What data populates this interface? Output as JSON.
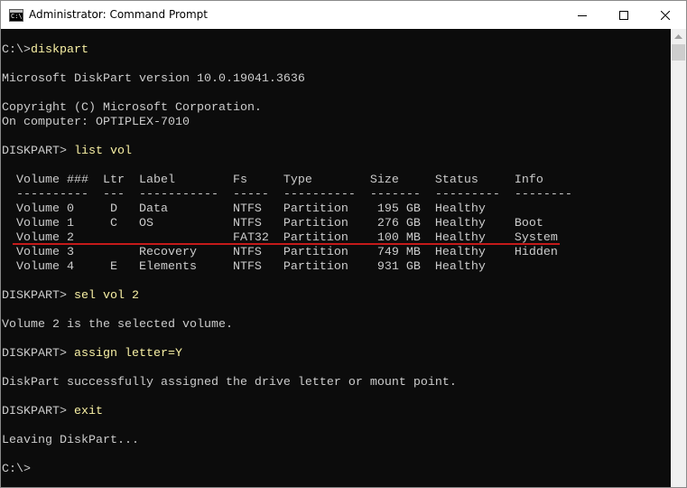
{
  "window": {
    "title": "Administrator: Command Prompt",
    "icon": "terminal-icon",
    "icon_glyph": "C:\\"
  },
  "colors": {
    "console_bg": "#0c0c0c",
    "console_text": "#cccccc",
    "command_text": "#f9f1a5",
    "underline": "#c41a1a"
  },
  "console": {
    "lines": [
      {
        "prompt": "C:\\>",
        "command": "diskpart"
      },
      {
        "text": ""
      },
      {
        "text": "Microsoft DiskPart version 10.0.19041.3636"
      },
      {
        "text": ""
      },
      {
        "text": "Copyright (C) Microsoft Corporation."
      },
      {
        "text": "On computer: OPTIPLEX-7010"
      },
      {
        "text": ""
      },
      {
        "prompt": "DISKPART> ",
        "command": "list vol"
      },
      {
        "text": ""
      },
      {
        "text": "  Volume ###  Ltr  Label        Fs     Type        Size     Status     Info"
      },
      {
        "text": "  ----------  ---  -----------  -----  ----------  -------  ---------  --------"
      },
      {
        "text": "  Volume 0     D   Data         NTFS   Partition    195 GB  Healthy"
      },
      {
        "text": "  Volume 1     C   OS           NTFS   Partition    276 GB  Healthy    Boot"
      },
      {
        "text": "  Volume 2                      FAT32  Partition    100 MB  Healthy    System"
      },
      {
        "text": "  Volume 3         Recovery     NTFS   Partition    749 MB  Healthy    Hidden"
      },
      {
        "text": "  Volume 4     E   Elements     NTFS   Partition    931 GB  Healthy"
      },
      {
        "text": ""
      },
      {
        "prompt": "DISKPART> ",
        "command": "sel vol 2"
      },
      {
        "text": ""
      },
      {
        "text": "Volume 2 is the selected volume."
      },
      {
        "text": ""
      },
      {
        "prompt": "DISKPART> ",
        "command": "assign letter=Y"
      },
      {
        "text": ""
      },
      {
        "text": "DiskPart successfully assigned the drive letter or mount point."
      },
      {
        "text": ""
      },
      {
        "prompt": "DISKPART> ",
        "command": "exit"
      },
      {
        "text": ""
      },
      {
        "text": "Leaving DiskPart..."
      },
      {
        "text": ""
      },
      {
        "prompt": "C:\\>",
        "command": ""
      }
    ]
  }
}
